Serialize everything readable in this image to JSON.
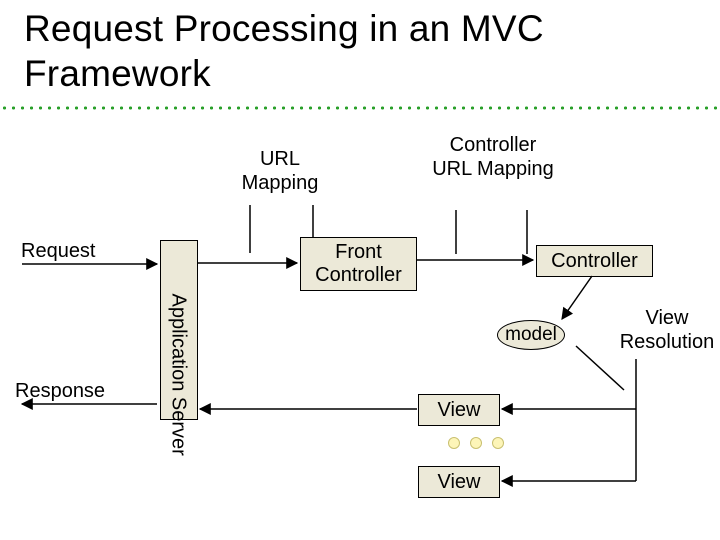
{
  "title": "Request Processing in an MVC\nFramework",
  "labels": {
    "url_mapping": "URL\nMapping",
    "ctrl_url_mapping": "Controller\nURL\nMapping",
    "request": "Request",
    "response": "Response",
    "app_server": "Application Server",
    "front_controller": "Front\nController",
    "controller": "Controller",
    "model": "model",
    "view_resolution": "View\nResolution",
    "view1": "View",
    "view2": "View"
  }
}
